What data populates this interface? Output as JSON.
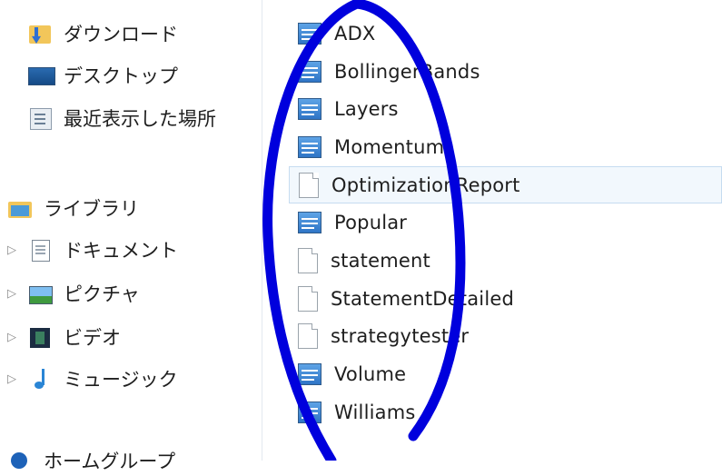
{
  "nav": {
    "favorites": [
      {
        "label": "ダウンロード",
        "icon": "download-folder-icon"
      },
      {
        "label": "デスクトップ",
        "icon": "desktop-icon"
      },
      {
        "label": "最近表示した場所",
        "icon": "recent-places-icon"
      }
    ],
    "library": {
      "label": "ライブラリ",
      "icon": "library-icon"
    },
    "library_items": [
      {
        "label": "ドキュメント",
        "icon": "documents-icon"
      },
      {
        "label": "ピクチャ",
        "icon": "pictures-icon"
      },
      {
        "label": "ビデオ",
        "icon": "videos-icon"
      },
      {
        "label": "ミュージック",
        "icon": "music-icon"
      }
    ],
    "homegroup": {
      "label": "ホームグループ",
      "icon": "homegroup-icon"
    }
  },
  "files": [
    {
      "name": "ADX",
      "icon": "config-file-icon"
    },
    {
      "name": "BollingerBands",
      "icon": "config-file-icon"
    },
    {
      "name": "Layers",
      "icon": "config-file-icon"
    },
    {
      "name": "Momentum",
      "icon": "config-file-icon"
    },
    {
      "name": "OptimizationReport",
      "icon": "blank-file-icon",
      "selected": true
    },
    {
      "name": "Popular",
      "icon": "config-file-icon"
    },
    {
      "name": "statement",
      "icon": "blank-file-icon"
    },
    {
      "name": "StatementDetailed",
      "icon": "blank-file-icon"
    },
    {
      "name": "strategytester",
      "icon": "blank-file-icon"
    },
    {
      "name": "Volume",
      "icon": "config-file-icon"
    },
    {
      "name": "Williams",
      "icon": "config-file-icon"
    }
  ],
  "colors": {
    "annotation_stroke": "#0000dd",
    "selection_bg": "#f2f8fd",
    "selection_border": "#c6dcf0"
  }
}
